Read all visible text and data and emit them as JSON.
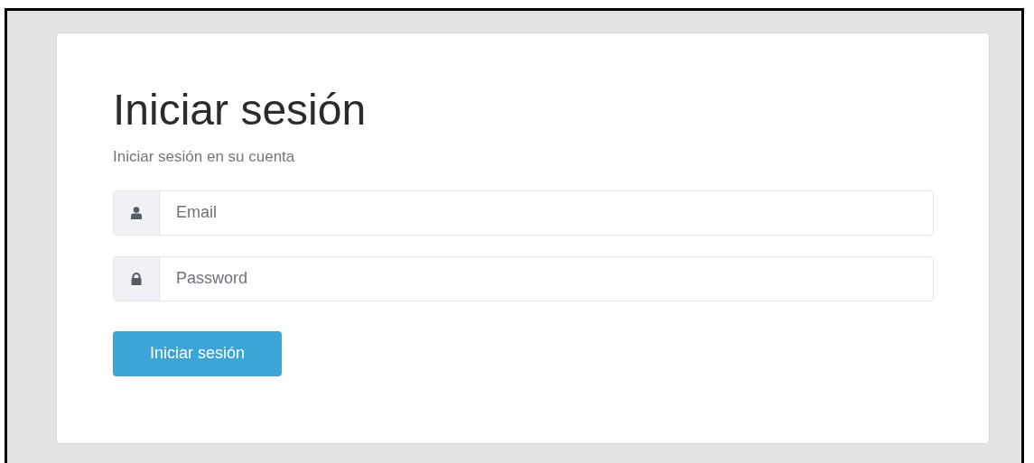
{
  "title": "Iniciar sesión",
  "subtitle": "Iniciar sesión en su cuenta",
  "fields": [
    {
      "kind": "user",
      "placeholder": "Email"
    },
    {
      "kind": "lock",
      "placeholder": "Password"
    }
  ],
  "submit_button": "Iniciar sesión"
}
